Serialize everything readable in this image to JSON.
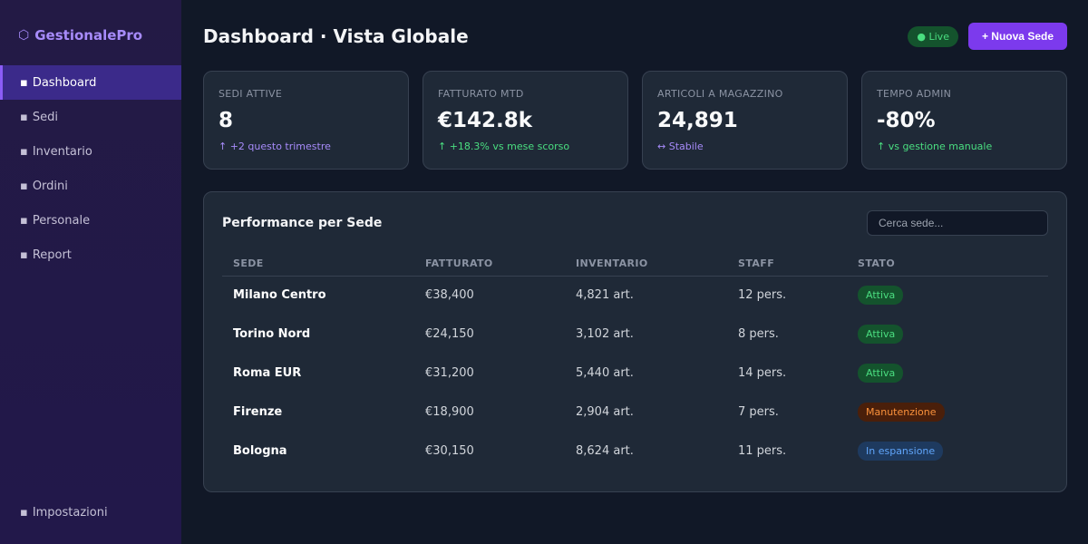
{
  "app": {
    "brand": "GestionalePro",
    "brand_icon": "hexagon-icon"
  },
  "sidebar": {
    "items": [
      {
        "label": "Dashboard",
        "active": true
      },
      {
        "label": "Sedi",
        "active": false
      },
      {
        "label": "Inventario",
        "active": false
      },
      {
        "label": "Ordini",
        "active": false
      },
      {
        "label": "Personale",
        "active": false
      },
      {
        "label": "Report",
        "active": false
      }
    ],
    "bottom": {
      "label": "Impostazioni"
    },
    "bullet": "▪"
  },
  "header": {
    "title": "Dashboard · Vista Globale",
    "live_badge": "● Live",
    "new_button": "+ Nuova Sede"
  },
  "stats": [
    {
      "label": "SEDI ATTIVE",
      "value": "8",
      "delta": "↑ +2 questo trimestre",
      "tone": "purple"
    },
    {
      "label": "FATTURATO MTD",
      "value": "€142.8k",
      "delta": "↑ +18.3% vs mese scorso",
      "tone": "green"
    },
    {
      "label": "ARTICOLI A MAGAZZINO",
      "value": "24,891",
      "delta": "↔ Stabile",
      "tone": "purple"
    },
    {
      "label": "TEMPO ADMIN",
      "value": "-80%",
      "delta": "↑ vs gestione manuale",
      "tone": "green"
    }
  ],
  "table": {
    "title": "Performance per Sede",
    "search_placeholder": "Cerca sede...",
    "columns": [
      "SEDE",
      "FATTURATO",
      "INVENTARIO",
      "STAFF",
      "STATO"
    ],
    "rows": [
      {
        "sede": "Milano Centro",
        "fatturato": "€38,400",
        "inventario": "4,821 art.",
        "staff": "12 pers.",
        "stato": "Attiva",
        "tone": "green"
      },
      {
        "sede": "Torino Nord",
        "fatturato": "€24,150",
        "inventario": "3,102 art.",
        "staff": "8 pers.",
        "stato": "Attiva",
        "tone": "green"
      },
      {
        "sede": "Roma EUR",
        "fatturato": "€31,200",
        "inventario": "5,440 art.",
        "staff": "14 pers.",
        "stato": "Attiva",
        "tone": "green"
      },
      {
        "sede": "Firenze",
        "fatturato": "€18,900",
        "inventario": "2,904 art.",
        "staff": "7 pers.",
        "stato": "Manutenzione",
        "tone": "orange"
      },
      {
        "sede": "Bologna",
        "fatturato": "€30,150",
        "inventario": "8,624 art.",
        "staff": "11 pers.",
        "stato": "In espansione",
        "tone": "blue"
      }
    ]
  },
  "colors": {
    "accent": "#7c3aed",
    "active_nav": "#3b2a8a",
    "green": "#4ade80",
    "orange": "#fb923c",
    "blue": "#60a5fa"
  }
}
